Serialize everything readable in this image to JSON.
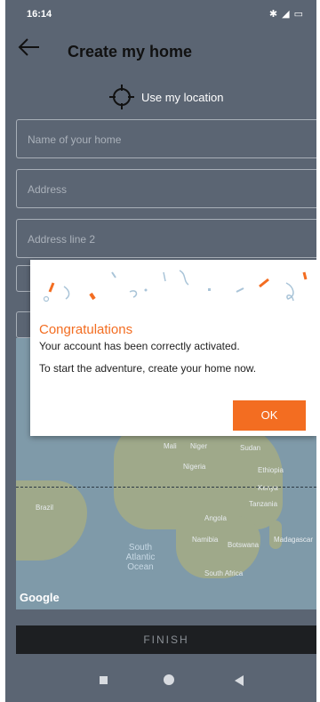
{
  "status_bar": {
    "time": "16:14",
    "icons": "✱ ◢ ▭"
  },
  "header": {
    "title": "Create my home"
  },
  "location": {
    "label": "Use my location"
  },
  "form": {
    "home_name_placeholder": "Name of your home",
    "address_placeholder": "Address",
    "address2_placeholder": "Address line 2"
  },
  "map": {
    "labels": [
      "Mali",
      "Niger",
      "Sudan",
      "Nigeria",
      "Ethiopia",
      "Kenya",
      "Tanzania",
      "Angola",
      "Brazil",
      "Namibia",
      "Botswana",
      "Madagascar",
      "South Africa"
    ],
    "ocean_label": "South\nAtlantic\nOcean",
    "attribution": "Google"
  },
  "footer": {
    "finish_label": "FINISH"
  },
  "dialog": {
    "title": "Congratulations",
    "message1": "Your account has been correctly activated.",
    "message2": "To start the adventure, create your home now.",
    "ok_label": "OK"
  },
  "colors": {
    "accent": "#f36d21",
    "overlay": "#5b6573"
  }
}
